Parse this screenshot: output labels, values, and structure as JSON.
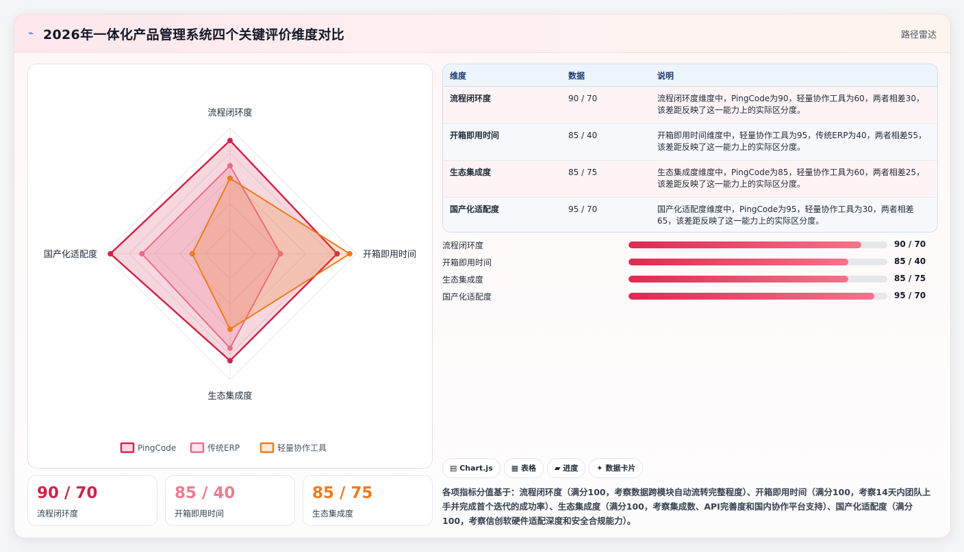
{
  "header": {
    "icon": "trend-icon",
    "title": "2026年一体化产品管理系统四个关键评价维度对比",
    "right_label": "路径雷达"
  },
  "chart_data": {
    "type": "radar",
    "axes": [
      "流程闭环度",
      "开箱即用时间",
      "生态集成度",
      "国产化适配度"
    ],
    "range": [
      0,
      100
    ],
    "rings": 5,
    "series": [
      {
        "name": "PingCode",
        "color": "#d0244a",
        "values": [
          90,
          85,
          85,
          95
        ]
      },
      {
        "name": "传统ERP",
        "color": "#ee6b87",
        "values": [
          70,
          40,
          75,
          70
        ]
      },
      {
        "name": "轻量协作工具",
        "color": "#ef7a1c",
        "values": [
          60,
          95,
          60,
          30
        ]
      }
    ]
  },
  "stats": [
    {
      "value": "90 / 70",
      "label": "流程闭环度",
      "color": "#d0244a"
    },
    {
      "value": "85 / 40",
      "label": "开箱即用时间",
      "color": "#f07a90"
    },
    {
      "value": "85 / 75",
      "label": "生态集成度",
      "color": "#ef7a1c"
    }
  ],
  "table": {
    "headers": [
      "维度",
      "数据",
      "说明"
    ],
    "rows": [
      {
        "dim": "流程闭环度",
        "data": "90 / 70",
        "desc": "流程闭环度维度中，PingCode为90，轻量协作工具为60，两者相差30，该差距反映了这一能力上的实际区分度。"
      },
      {
        "dim": "开箱即用时间",
        "data": "85 / 40",
        "desc": "开箱即用时间维度中，轻量协作工具为95，传统ERP为40，两者相差55，该差距反映了这一能力上的实际区分度。"
      },
      {
        "dim": "生态集成度",
        "data": "85 / 75",
        "desc": "生态集成度维度中，PingCode为85，轻量协作工具为60，两者相差25，该差距反映了这一能力上的实际区分度。"
      },
      {
        "dim": "国产化适配度",
        "data": "95 / 70",
        "desc": "国产化适配度维度中，PingCode为95，轻量协作工具为30，两者相差65，该差距反映了这一能力上的实际区分度。"
      }
    ]
  },
  "progress": [
    {
      "name": "流程闭环度",
      "value": "90 / 70",
      "fill_percent": 90
    },
    {
      "name": "开箱即用时间",
      "value": "85 / 40",
      "fill_percent": 85
    },
    {
      "name": "生态集成度",
      "value": "85 / 75",
      "fill_percent": 85
    },
    {
      "name": "国产化适配度",
      "value": "95 / 70",
      "fill_percent": 95
    }
  ],
  "chips": [
    {
      "icon": "▤",
      "label": "Chart.js"
    },
    {
      "icon": "▦",
      "label": "表格"
    },
    {
      "icon": "▰",
      "label": "进度"
    },
    {
      "icon": "✦",
      "label": "数据卡片"
    }
  ],
  "note": "各项指标分值基于：流程闭环度（满分100，考察数据跨模块自动流转完整程度）、开箱即用时间（满分100，考察14天内团队上手并完成首个迭代的成功率）、生态集成度（满分100，考察集成数、API完善度和国内协作平台支持）、国产化适配度（满分100，考察信创软硬件适配深度和安全合规能力）。"
}
